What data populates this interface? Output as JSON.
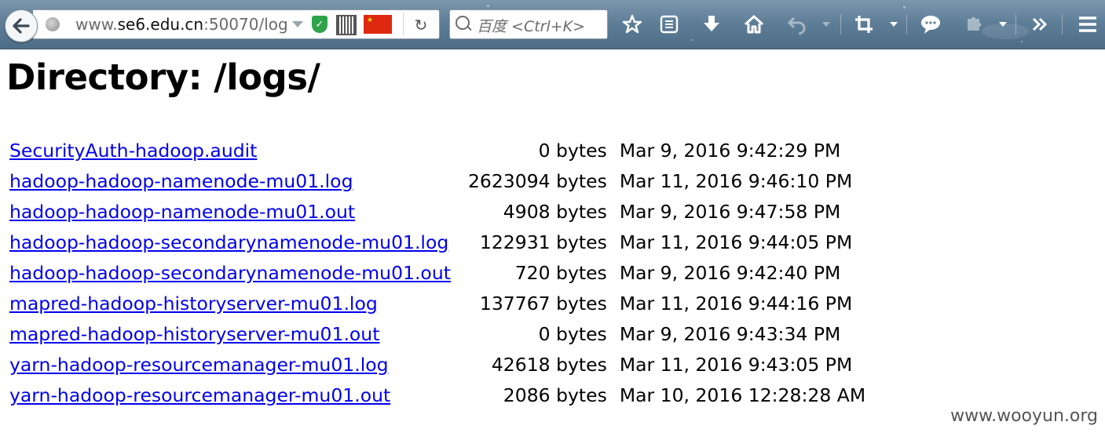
{
  "browser": {
    "url_prefix": "www.",
    "url_host": "se6.edu.cn",
    "url_suffix": ":50070/log",
    "search_placeholder": "百度 <Ctrl+K>",
    "colors": {
      "toolbar": "#5f7f98",
      "link": "#0000ee",
      "flag_red": "#de2910",
      "shield_green": "#2fa34a"
    },
    "icons": [
      "back-arrow-icon",
      "globe-icon",
      "url-dropdown-icon",
      "shield-icon",
      "qr-code-icon",
      "china-flag-icon",
      "reload-icon",
      "search-icon",
      "bookmark-star-icon",
      "reading-list-icon",
      "download-icon",
      "home-icon",
      "undo-icon",
      "crop-icon",
      "chat-bubble-icon",
      "extension-icon",
      "overflow-chevron-icon",
      "hamburger-menu-icon"
    ]
  },
  "page": {
    "title": "Directory: /logs/",
    "files": [
      {
        "name": "SecurityAuth-hadoop.audit ",
        "size": "0 bytes",
        "date": "Mar 9, 2016 9:42:29 PM"
      },
      {
        "name": "hadoop-hadoop-namenode-mu01.log ",
        "size": "2623094 bytes",
        "date": "Mar 11, 2016 9:46:10 PM"
      },
      {
        "name": "hadoop-hadoop-namenode-mu01.out ",
        "size": "4908 bytes",
        "date": "Mar 9, 2016 9:47:58 PM"
      },
      {
        "name": "hadoop-hadoop-secondarynamenode-mu01.log ",
        "size": "122931 bytes",
        "date": "Mar 11, 2016 9:44:05 PM"
      },
      {
        "name": "hadoop-hadoop-secondarynamenode-mu01.out ",
        "size": "720 bytes",
        "date": "Mar 9, 2016 9:42:40 PM"
      },
      {
        "name": "mapred-hadoop-historyserver-mu01.log ",
        "size": "137767 bytes",
        "date": "Mar 11, 2016 9:44:16 PM"
      },
      {
        "name": "mapred-hadoop-historyserver-mu01.out ",
        "size": "0 bytes",
        "date": "Mar 9, 2016 9:43:34 PM"
      },
      {
        "name": "yarn-hadoop-resourcemanager-mu01.log ",
        "size": "42618 bytes",
        "date": "Mar 11, 2016 9:43:05 PM"
      },
      {
        "name": "yarn-hadoop-resourcemanager-mu01.out ",
        "size": "2086 bytes",
        "date": "Mar 10, 2016 12:28:28 AM"
      }
    ]
  },
  "watermark": "www.wooyun.org"
}
